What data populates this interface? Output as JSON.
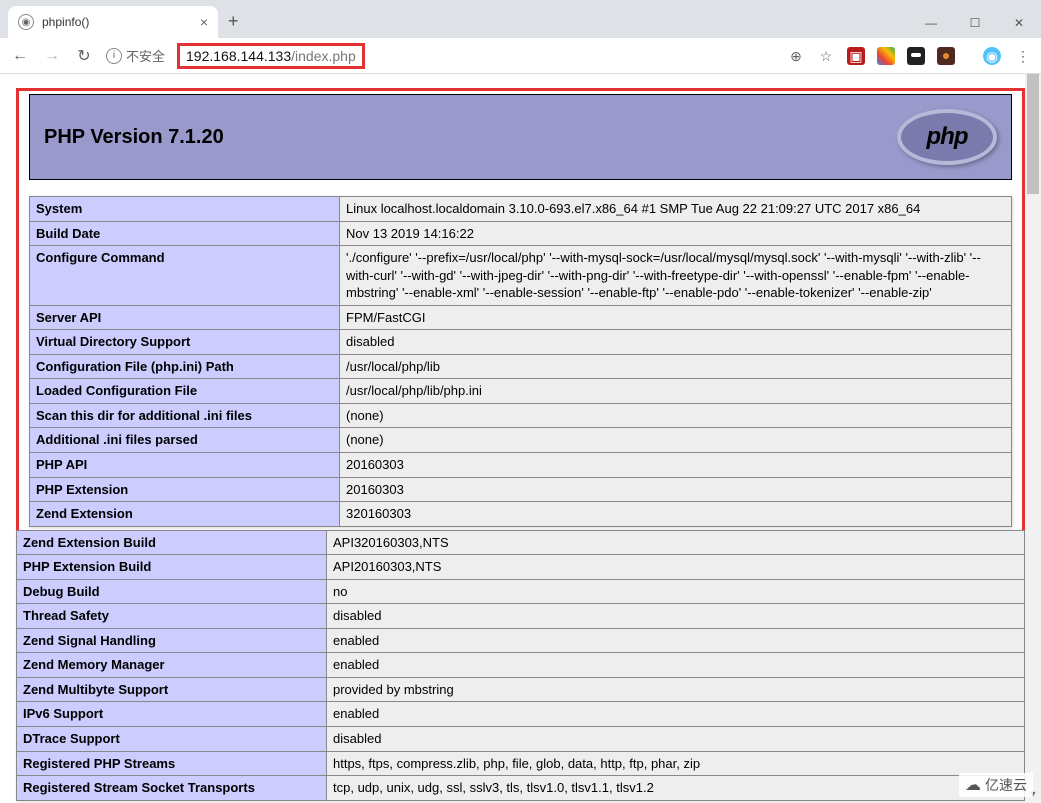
{
  "browser": {
    "tab_title": "phpinfo()",
    "security_label": "不安全",
    "url_host": "192.168.144.133",
    "url_path": "/index.php"
  },
  "header": {
    "title": "PHP Version 7.1.20",
    "logo_text": "php"
  },
  "rows": [
    {
      "k": "System",
      "v": "Linux localhost.localdomain 3.10.0-693.el7.x86_64 #1 SMP Tue Aug 22 21:09:27 UTC 2017 x86_64"
    },
    {
      "k": "Build Date",
      "v": "Nov 13 2019 14:16:22"
    },
    {
      "k": "Configure Command",
      "v": "'./configure' '--prefix=/usr/local/php' '--with-mysql-sock=/usr/local/mysql/mysql.sock' '--with-mysqli' '--with-zlib' '--with-curl' '--with-gd' '--with-jpeg-dir' '--with-png-dir' '--with-freetype-dir' '--with-openssl' '--enable-fpm' '--enable-mbstring' '--enable-xml' '--enable-session' '--enable-ftp' '--enable-pdo' '--enable-tokenizer' '--enable-zip'"
    },
    {
      "k": "Server API",
      "v": "FPM/FastCGI"
    },
    {
      "k": "Virtual Directory Support",
      "v": "disabled"
    },
    {
      "k": "Configuration File (php.ini) Path",
      "v": "/usr/local/php/lib"
    },
    {
      "k": "Loaded Configuration File",
      "v": "/usr/local/php/lib/php.ini"
    },
    {
      "k": "Scan this dir for additional .ini files",
      "v": "(none)"
    },
    {
      "k": "Additional .ini files parsed",
      "v": "(none)"
    },
    {
      "k": "PHP API",
      "v": "20160303"
    },
    {
      "k": "PHP Extension",
      "v": "20160303"
    },
    {
      "k": "Zend Extension",
      "v": "320160303"
    },
    {
      "k": "Zend Extension Build",
      "v": "API320160303,NTS"
    },
    {
      "k": "PHP Extension Build",
      "v": "API20160303,NTS"
    },
    {
      "k": "Debug Build",
      "v": "no"
    },
    {
      "k": "Thread Safety",
      "v": "disabled"
    },
    {
      "k": "Zend Signal Handling",
      "v": "enabled"
    },
    {
      "k": "Zend Memory Manager",
      "v": "enabled"
    },
    {
      "k": "Zend Multibyte Support",
      "v": "provided by mbstring"
    },
    {
      "k": "IPv6 Support",
      "v": "enabled"
    },
    {
      "k": "DTrace Support",
      "v": "disabled"
    },
    {
      "k": "Registered PHP Streams",
      "v": "https, ftps, compress.zlib, php, file, glob, data, http, ftp, phar, zip"
    },
    {
      "k": "Registered Stream Socket Transports",
      "v": "tcp, udp, unix, udg, ssl, sslv3, tls, tlsv1.0, tlsv1.1, tlsv1.2"
    }
  ],
  "boxed_row_count": 12,
  "watermark": "亿速云"
}
